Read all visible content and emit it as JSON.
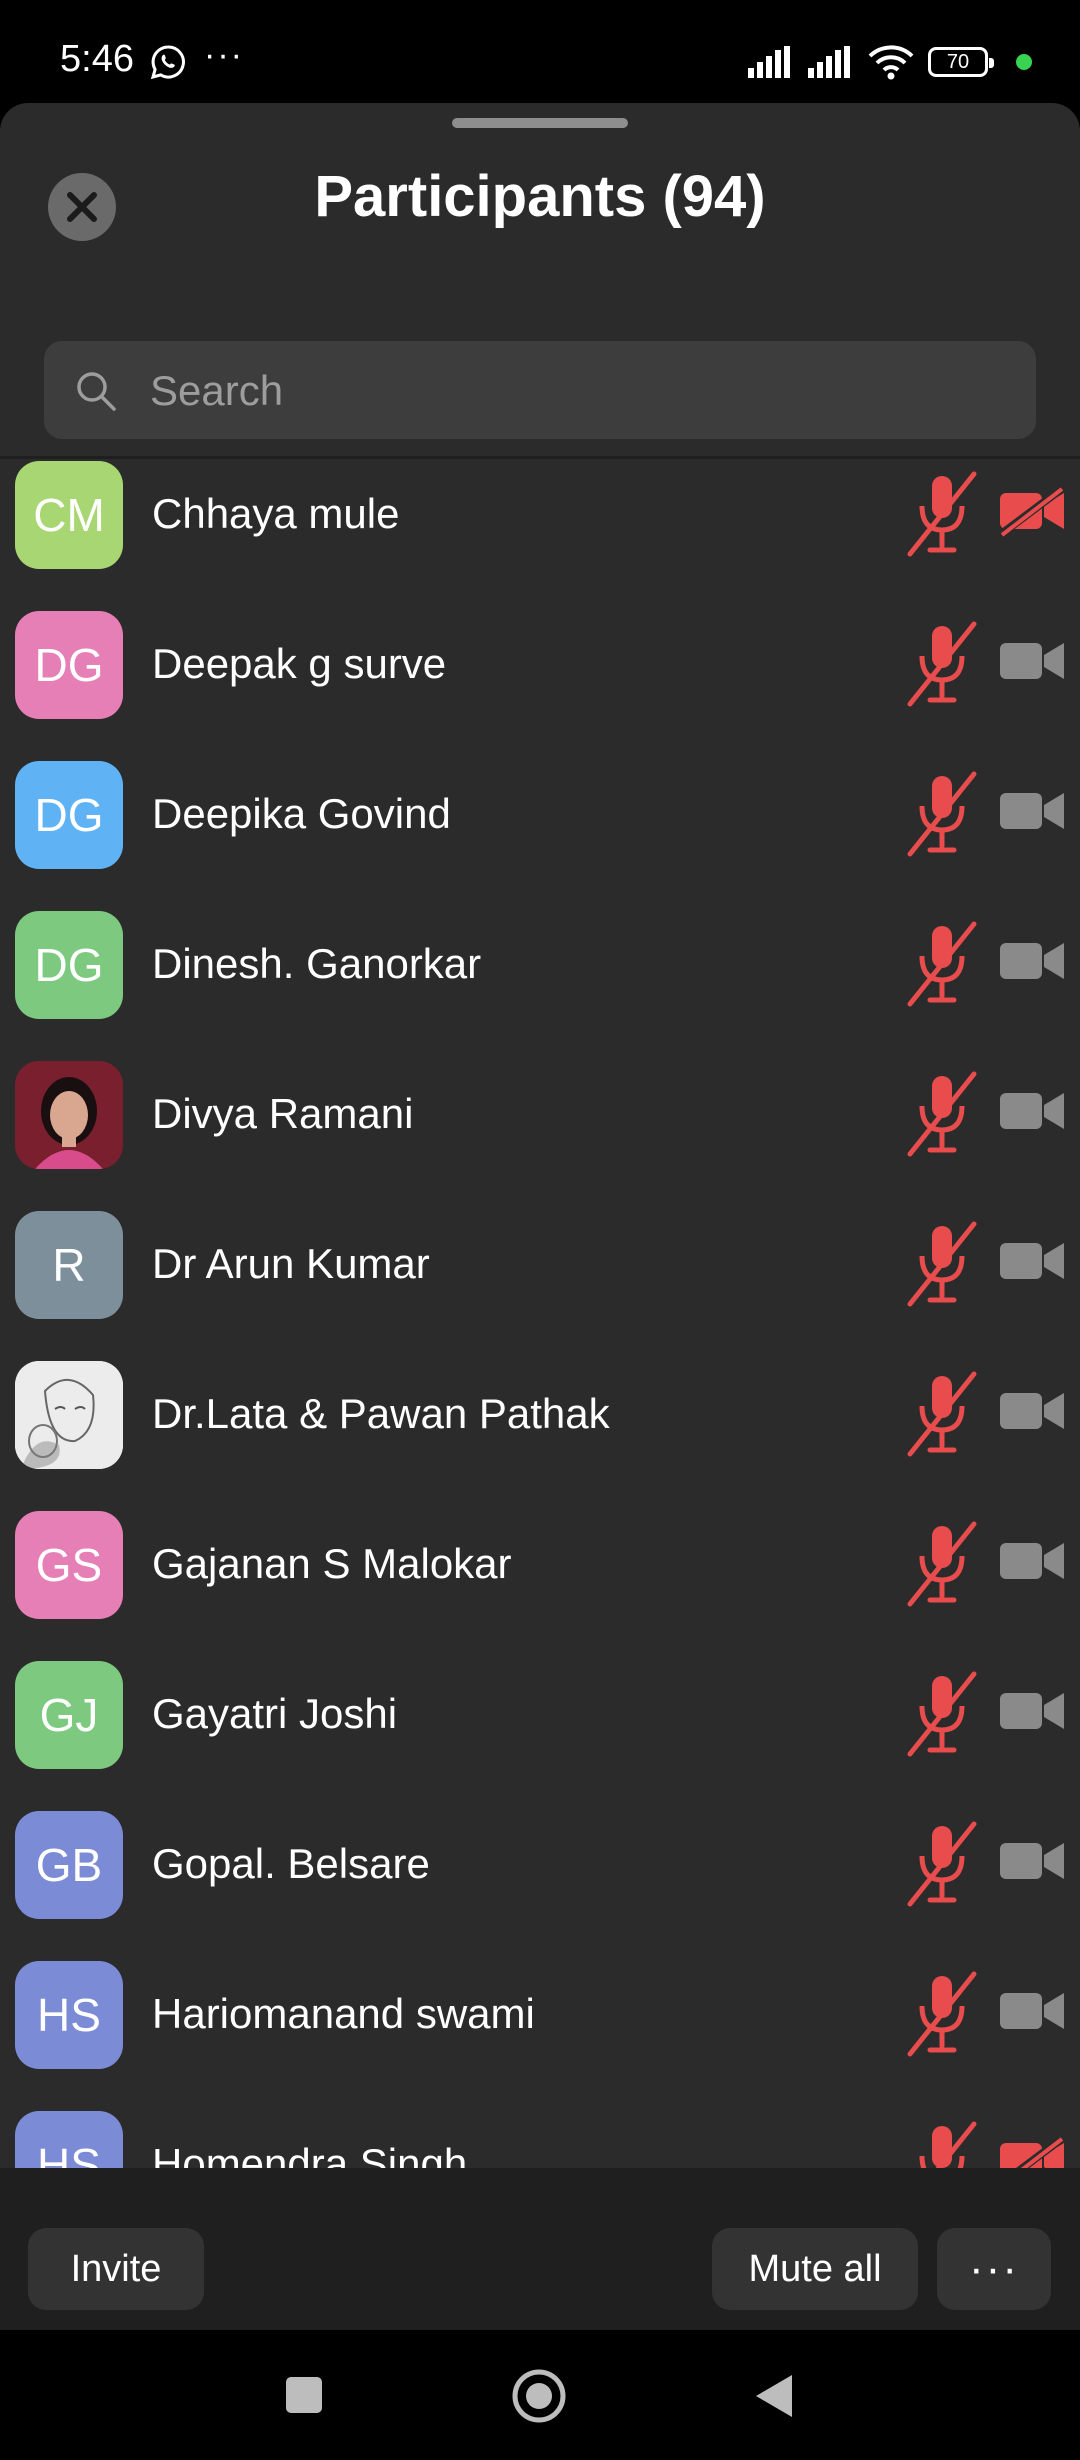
{
  "status_bar": {
    "time": "5:46",
    "more": "···",
    "battery": "70",
    "icons": [
      "whatsapp-icon",
      "signal-icon",
      "wifi-icon",
      "battery-icon"
    ]
  },
  "sheet": {
    "title": "Participants (94)",
    "search_placeholder": "Search"
  },
  "participants": [
    {
      "initials": "CM",
      "name": "Chhaya mule",
      "color": "#a8d672",
      "mic": "muted",
      "video": "off"
    },
    {
      "initials": "DG",
      "name": "Deepak g surve",
      "color": "#e67fb5",
      "mic": "muted",
      "video": "on"
    },
    {
      "initials": "DG",
      "name": "Deepika Govind",
      "color": "#5fb3f5",
      "mic": "muted",
      "video": "on"
    },
    {
      "initials": "DG",
      "name": "Dinesh. Ganorkar",
      "color": "#7dc97f",
      "mic": "muted",
      "video": "on"
    },
    {
      "initials": "",
      "name": "Divya Ramani",
      "color": "#7a1f2e",
      "mic": "muted",
      "video": "on",
      "photo": true
    },
    {
      "initials": "R",
      "name": "Dr Arun Kumar",
      "color": "#7c8f9b",
      "mic": "muted",
      "video": "on"
    },
    {
      "initials": "",
      "name": "Dr.Lata & Pawan Pathak",
      "color": "#e6e6e6",
      "mic": "muted",
      "video": "on",
      "photo": true
    },
    {
      "initials": "GS",
      "name": "Gajanan S Malokar",
      "color": "#e67fb5",
      "mic": "muted",
      "video": "on"
    },
    {
      "initials": "GJ",
      "name": "Gayatri Joshi",
      "color": "#7dc97f",
      "mic": "muted",
      "video": "on"
    },
    {
      "initials": "GB",
      "name": "Gopal. Belsare",
      "color": "#7b8bd6",
      "mic": "muted",
      "video": "on"
    },
    {
      "initials": "HS",
      "name": "Hariomanand swami",
      "color": "#7b8bd6",
      "mic": "muted",
      "video": "on"
    },
    {
      "initials": "HS",
      "name": "Homendra Singh",
      "color": "#7b8bd6",
      "mic": "muted",
      "video": "off"
    }
  ],
  "bottom_bar": {
    "invite": "Invite",
    "mute_all": "Mute all",
    "more": "···"
  },
  "colors": {
    "accent_red": "#e84c4c",
    "cam_gray": "#8a8a8a"
  }
}
